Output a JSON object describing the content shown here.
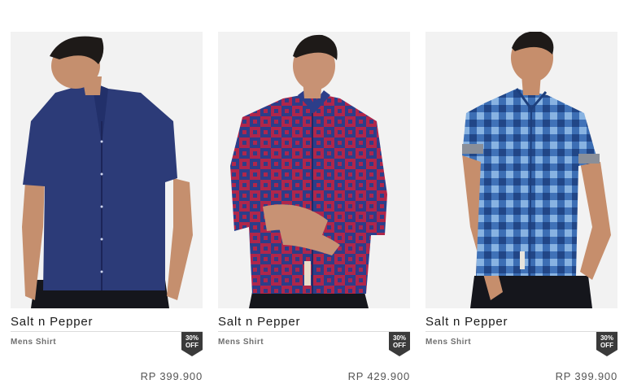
{
  "products": [
    {
      "brand": "Salt n Pepper",
      "category": "Mens Shirt",
      "discount_line1": "30%",
      "discount_line2": "OFF",
      "price": "RP 399.900",
      "image_alt": "Navy short-sleeve shirt"
    },
    {
      "brand": "Salt n Pepper",
      "category": "Mens Shirt",
      "discount_line1": "30%",
      "discount_line2": "OFF",
      "price": "RP 429.900",
      "image_alt": "Red and navy checked long-sleeve shirt"
    },
    {
      "brand": "Salt n Pepper",
      "category": "Mens Shirt",
      "discount_line1": "30%",
      "discount_line2": "OFF",
      "price": "RP 399.900",
      "image_alt": "Blue gingham short-sleeve shirt"
    }
  ],
  "colors": {
    "badge": "#3a3a3a",
    "photo_bg": "#f2f2f2",
    "separator": "#dcdcdc"
  }
}
